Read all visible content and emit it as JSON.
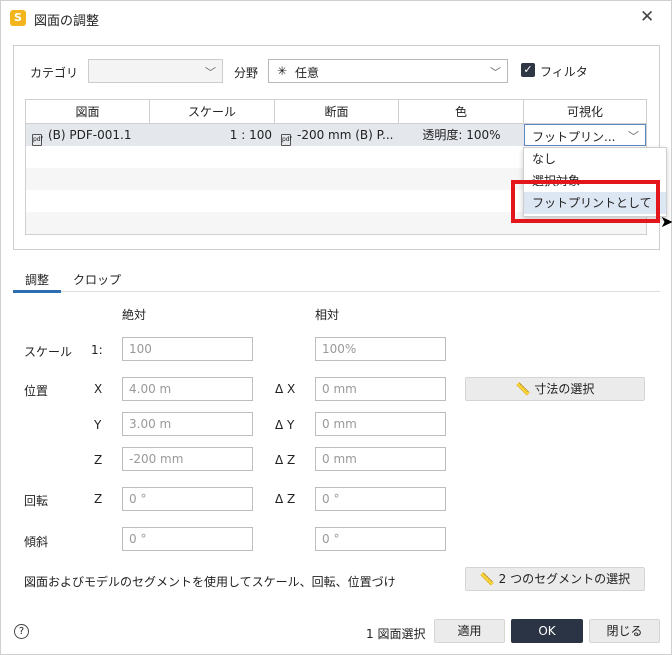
{
  "window": {
    "title": "図面の調整",
    "logo": "S"
  },
  "filters": {
    "category_label": "カテゴリ",
    "category_value": "",
    "field_label": "分野",
    "field_value": "任意",
    "filter_label": "フィルタ",
    "filter_checked": true
  },
  "table": {
    "headers": [
      "図面",
      "スケール",
      "断面",
      "色",
      "可視化"
    ],
    "rows": [
      {
        "drawing": "(B) PDF-001.1",
        "scale": "1 : 100",
        "section": "-200 mm (B) P...",
        "color": "透明度: 100%",
        "visualization": "フットプリン..."
      }
    ]
  },
  "dropdown": {
    "options": [
      "なし",
      "選択対象",
      "フットプリントとして"
    ],
    "highlighted": "フットプリントとして"
  },
  "tabs": [
    "調整",
    "クロップ"
  ],
  "adjust": {
    "absolute_header": "絶対",
    "relative_header": "相対",
    "scale_label": "スケール",
    "scale_prefix": "1:",
    "scale_abs": "100",
    "scale_rel": "100%",
    "position_label": "位置",
    "x_label": "X",
    "x_abs": "4.00 m",
    "dx_label": "Δ X",
    "dx_rel": "0 mm",
    "y_label": "Y",
    "y_abs": "3.00 m",
    "dy_label": "Δ Y",
    "dy_rel": "0 mm",
    "z_label": "Z",
    "z_abs": "-200 mm",
    "dz_label": "Δ Z",
    "dz_rel": "0 mm",
    "rotation_label": "回転",
    "rz_label": "Z",
    "rot_abs": "0 °",
    "drz_label": "Δ Z",
    "rot_rel": "0 °",
    "tilt_label": "傾斜",
    "tilt_abs": "0 °",
    "tilt_rel": "0 °",
    "measure_button": "寸法の選択",
    "segment_note": "図面およびモデルのセグメントを使用してスケール、回転、位置づけ",
    "segment_button": "2 つのセグメントの選択"
  },
  "footer": {
    "selection_count": "1 図面選択",
    "apply": "適用",
    "ok": "OK",
    "close": "閉じる"
  }
}
